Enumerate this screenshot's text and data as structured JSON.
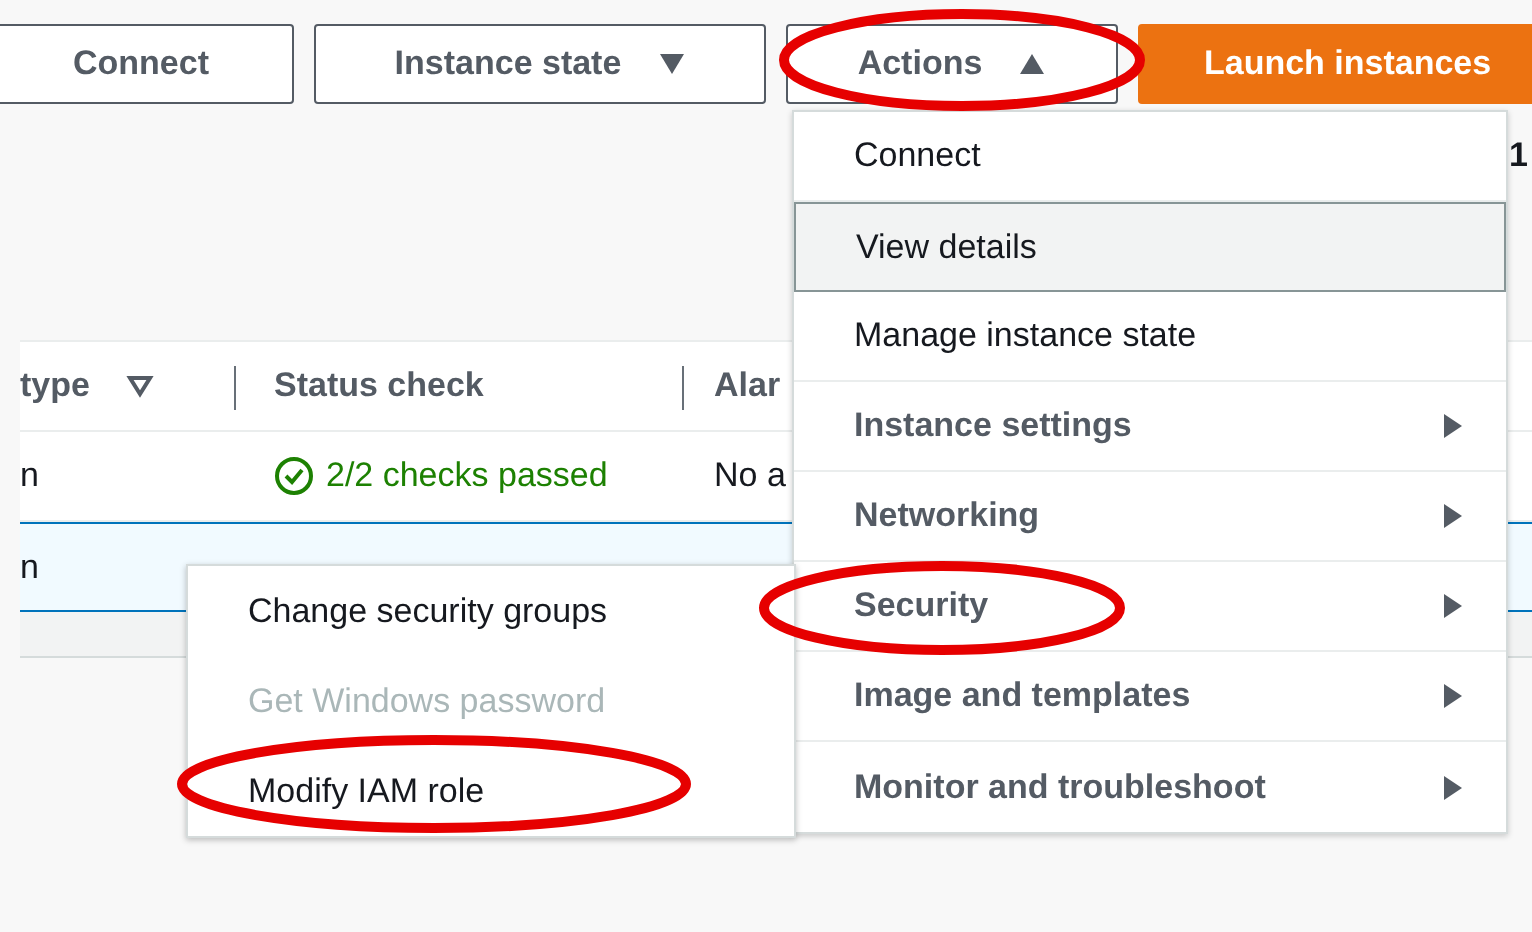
{
  "toolbar": {
    "buttons": [
      {
        "label": "Connect",
        "kind": "plain"
      },
      {
        "label": "Instance state",
        "kind": "dropdown",
        "expanded": false
      },
      {
        "label": "Actions",
        "kind": "dropdown",
        "expanded": true
      },
      {
        "label": "Launch instances",
        "kind": "primary"
      }
    ]
  },
  "page_number": "1",
  "table": {
    "columns": [
      {
        "label": "type",
        "sortable": true
      },
      {
        "label": "Status check",
        "sortable": false
      },
      {
        "label": "Alar"
      }
    ],
    "rows": [
      {
        "name": "n",
        "status": "2/2 checks passed",
        "alarm": "No a",
        "selected": false
      },
      {
        "name": "n",
        "selected": true
      }
    ]
  },
  "actions_menu": {
    "items": [
      {
        "label": "Connect",
        "kind": "action",
        "highlighted": false
      },
      {
        "label": "View details",
        "kind": "action",
        "highlighted": true
      },
      {
        "label": "Manage instance state",
        "kind": "action",
        "highlighted": false
      },
      {
        "label": "Instance settings",
        "kind": "submenu",
        "highlighted": false
      },
      {
        "label": "Networking",
        "kind": "submenu",
        "highlighted": false
      },
      {
        "label": "Security",
        "kind": "submenu",
        "highlighted": false
      },
      {
        "label": "Image and templates",
        "kind": "submenu",
        "highlighted": false
      },
      {
        "label": "Monitor and troubleshoot",
        "kind": "submenu",
        "highlighted": false
      }
    ]
  },
  "security_submenu": {
    "items": [
      {
        "label": "Change security groups",
        "disabled": false
      },
      {
        "label": "Get Windows password",
        "disabled": true
      },
      {
        "label": "Modify IAM role",
        "disabled": false
      }
    ]
  }
}
